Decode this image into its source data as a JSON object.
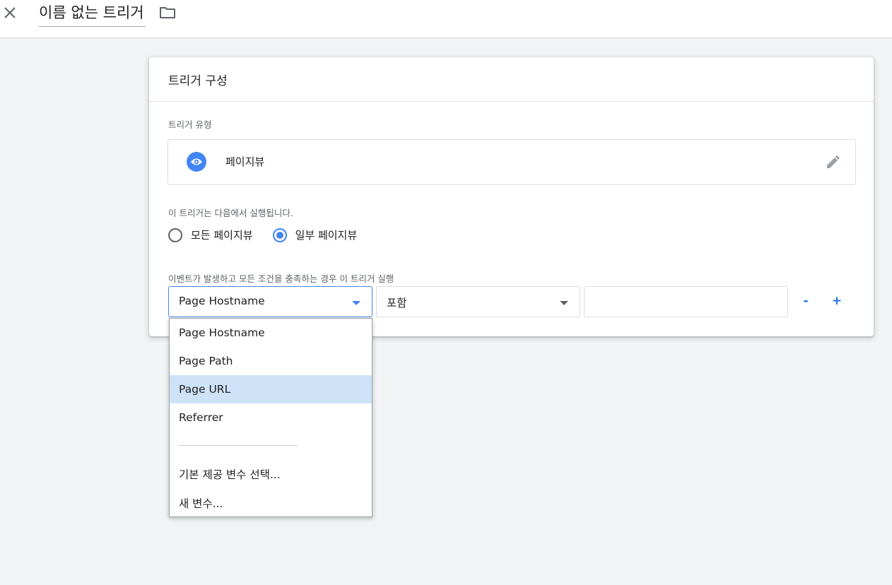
{
  "header": {
    "title": "이름 없는 트리거",
    "close_icon": "close-icon",
    "folder_icon": "folder-icon"
  },
  "card": {
    "title": "트리거 구성",
    "type_label": "트리거 유형",
    "type_value": "페이지뷰",
    "type_icon": "eye-icon",
    "edit_icon": "pencil-icon",
    "fires_on_label": "이 트리거는 다음에서 실행됩니다.",
    "radio_options": [
      {
        "label": "모든 페이지뷰",
        "checked": false
      },
      {
        "label": "일부 페이지뷰",
        "checked": true
      }
    ],
    "condition_label": "이벤트가 발생하고 모든 조건을 충족하는 경우 이 트리거 실행",
    "condition": {
      "variable": "Page Hostname",
      "operator": "포함",
      "value": ""
    },
    "remove_label": "-",
    "add_label": "+"
  },
  "dropdown": {
    "items": [
      "Page Hostname",
      "Page Path",
      "Page URL",
      "Referrer"
    ],
    "highlighted": "Page URL",
    "extra_items": [
      "기본 제공 변수 선택...",
      "새 변수..."
    ]
  },
  "colors": {
    "accent": "#4285f4",
    "highlight": "#cfe3f8",
    "background": "#f1f3f4"
  }
}
